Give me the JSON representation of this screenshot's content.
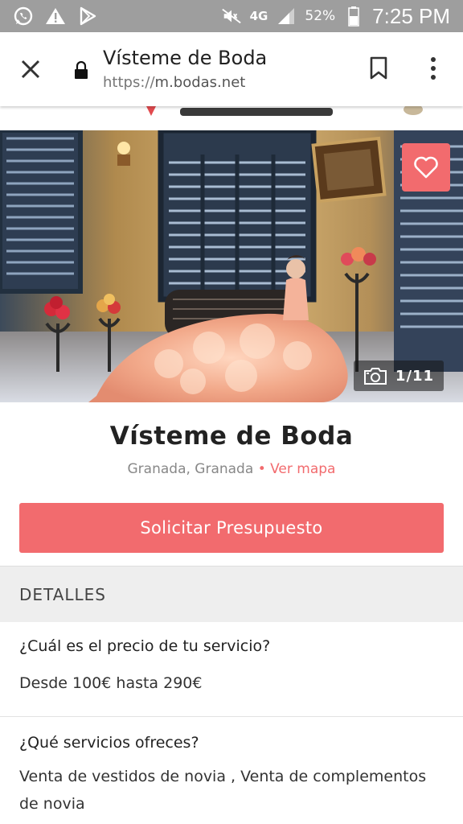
{
  "status_bar": {
    "network": "4G",
    "battery": "52%",
    "time": "7:25 PM",
    "icons": [
      "whatsapp-icon",
      "warning-icon",
      "play-store-icon",
      "mute-icon",
      "signal-icon",
      "battery-icon"
    ]
  },
  "browser": {
    "title": "Vísteme de Boda",
    "url_scheme": "https://",
    "url_host": "m.bodas.net",
    "icons": [
      "close-icon",
      "lock-icon",
      "bookmark-icon",
      "more-vert-icon"
    ]
  },
  "hero": {
    "photo_counter": "1/11",
    "favorite_icon": "heart-icon",
    "camera_icon": "camera-icon"
  },
  "vendor": {
    "name": "Vísteme de Boda",
    "location": "Granada, Granada",
    "separator": "•",
    "map_link": "Ver mapa"
  },
  "cta": {
    "label": "Solicitar Presupuesto"
  },
  "details": {
    "header": "DETALLES",
    "items": [
      {
        "question": "¿Cuál es el precio de tu servicio?",
        "answer": "Desde 100€ hasta 290€"
      },
      {
        "question": "¿Qué servicios ofreces?",
        "answer": "Venta de vestidos de novia , Venta de complementos de novia"
      }
    ]
  },
  "colors": {
    "accent": "#f26b6e",
    "status_bar": "#9e9e9e",
    "section_bg": "#eeeeee"
  }
}
